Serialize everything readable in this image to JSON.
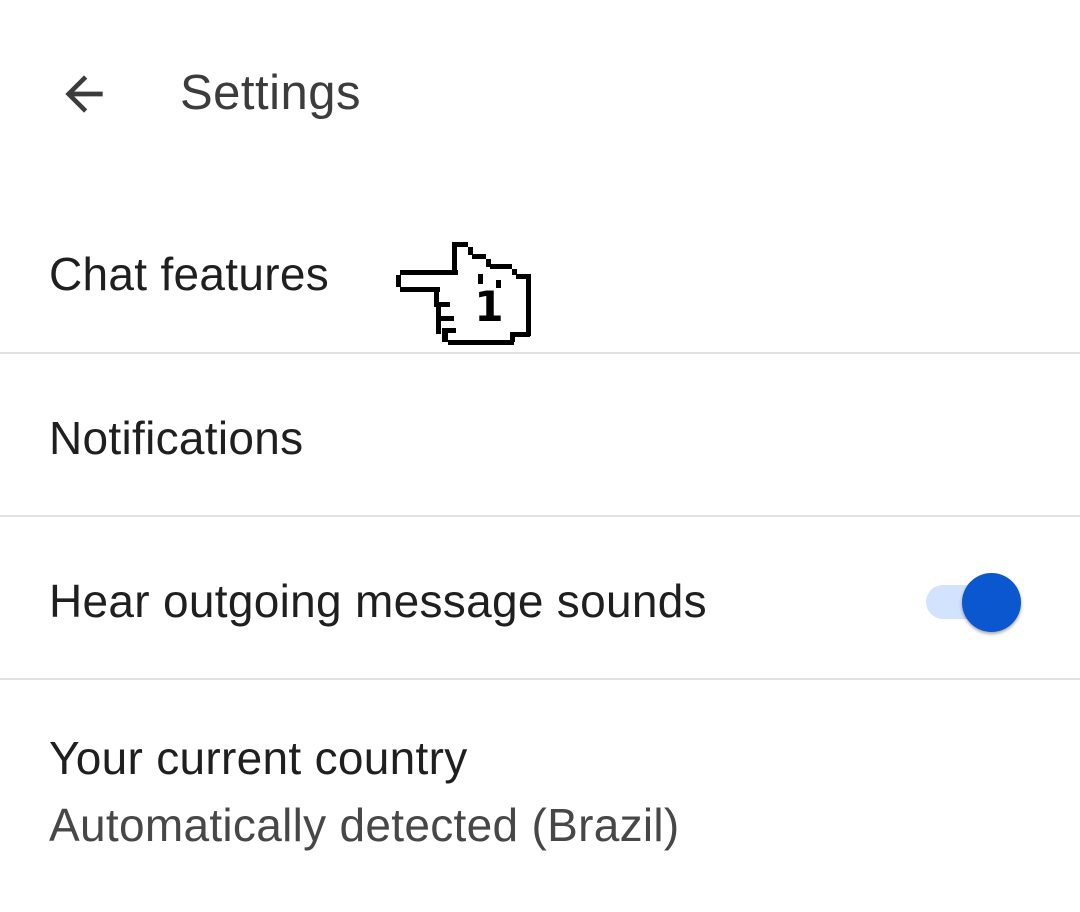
{
  "header": {
    "title": "Settings",
    "back_icon": "arrow-left-icon"
  },
  "settings": {
    "items": [
      {
        "label": "Chat features"
      },
      {
        "label": "Notifications"
      },
      {
        "label": "Hear outgoing message sounds",
        "toggle_on": true
      },
      {
        "label": "Your current country",
        "sublabel": "Automatically detected (Brazil)"
      }
    ]
  },
  "cursor": {
    "icon": "pointing-hand-cursor-icon",
    "badge": "1"
  },
  "colors": {
    "accent": "#0b57d0",
    "toggle_track": "#d3e3fd",
    "divider": "#e2e2e2",
    "text_primary": "#1f1f1f",
    "text_secondary": "#474747"
  }
}
